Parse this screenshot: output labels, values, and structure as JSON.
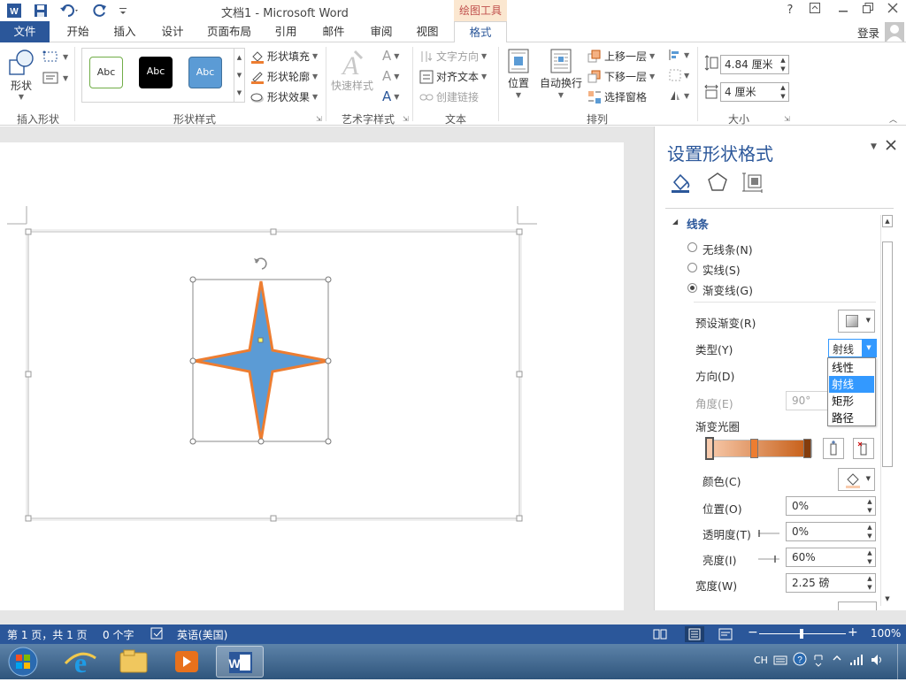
{
  "titlebar": {
    "title": "文档1 - Microsoft Word",
    "context_tab": "绘图工具",
    "help": "?"
  },
  "menu": {
    "tabs": [
      "文件",
      "开始",
      "插入",
      "设计",
      "页面布局",
      "引用",
      "邮件",
      "审阅",
      "视图",
      "格式"
    ],
    "login": "登录"
  },
  "ribbon": {
    "insert_shapes": {
      "shapes_label": "形状",
      "group_label": "插入形状"
    },
    "shape_styles": {
      "styles": [
        "Abc",
        "Abc",
        "Abc"
      ],
      "fill": "形状填充",
      "outline": "形状轮廓",
      "effects": "形状效果",
      "group_label": "形状样式"
    },
    "wordart": {
      "quick_styles": "快速样式",
      "group_label": "艺术字样式"
    },
    "text": {
      "direction": "文字方向",
      "align": "对齐文本",
      "link": "创建链接",
      "group_label": "文本"
    },
    "arrange": {
      "position": "位置",
      "wrap": "自动换行",
      "forward": "上移一层",
      "backward": "下移一层",
      "selection_pane": "选择窗格",
      "group_label": "排列"
    },
    "size": {
      "height": "4.84 厘米",
      "width": "4 厘米",
      "group_label": "大小"
    }
  },
  "pane": {
    "title": "设置形状格式",
    "section": "线条",
    "line_options": [
      "无线条(N)",
      "实线(S)",
      "渐变线(G)"
    ],
    "selected_line_option": 2,
    "preset_gradient": "预设渐变(R)",
    "type_label": "类型(Y)",
    "type_value": "射线",
    "direction_label": "方向(D)",
    "angle_label": "角度(E)",
    "angle_value": "90°",
    "gradient_stops_label": "渐变光圈",
    "color_label": "颜色(C)",
    "position_label": "位置(O)",
    "position_value": "0%",
    "transparency_label": "透明度(T)",
    "transparency_value": "0%",
    "brightness_label": "亮度(I)",
    "brightness_value": "60%",
    "width_label": "宽度(W)",
    "width_value": "2.25 磅",
    "type_options": [
      "线性",
      "射线",
      "矩形",
      "路径"
    ],
    "type_selected_index": 1
  },
  "colors": {
    "accent": "#2b579a",
    "star_fill": "#5b9bd5",
    "star_outline": "#ed7d31",
    "gradient_start": "#f4b183",
    "gradient_end": "#c55a11"
  },
  "status": {
    "page": "第 1 页，共 1 页",
    "words": "0 个字",
    "language": "英语(美国)",
    "zoom": "100%"
  },
  "taskbar": {
    "ime": "CH"
  }
}
